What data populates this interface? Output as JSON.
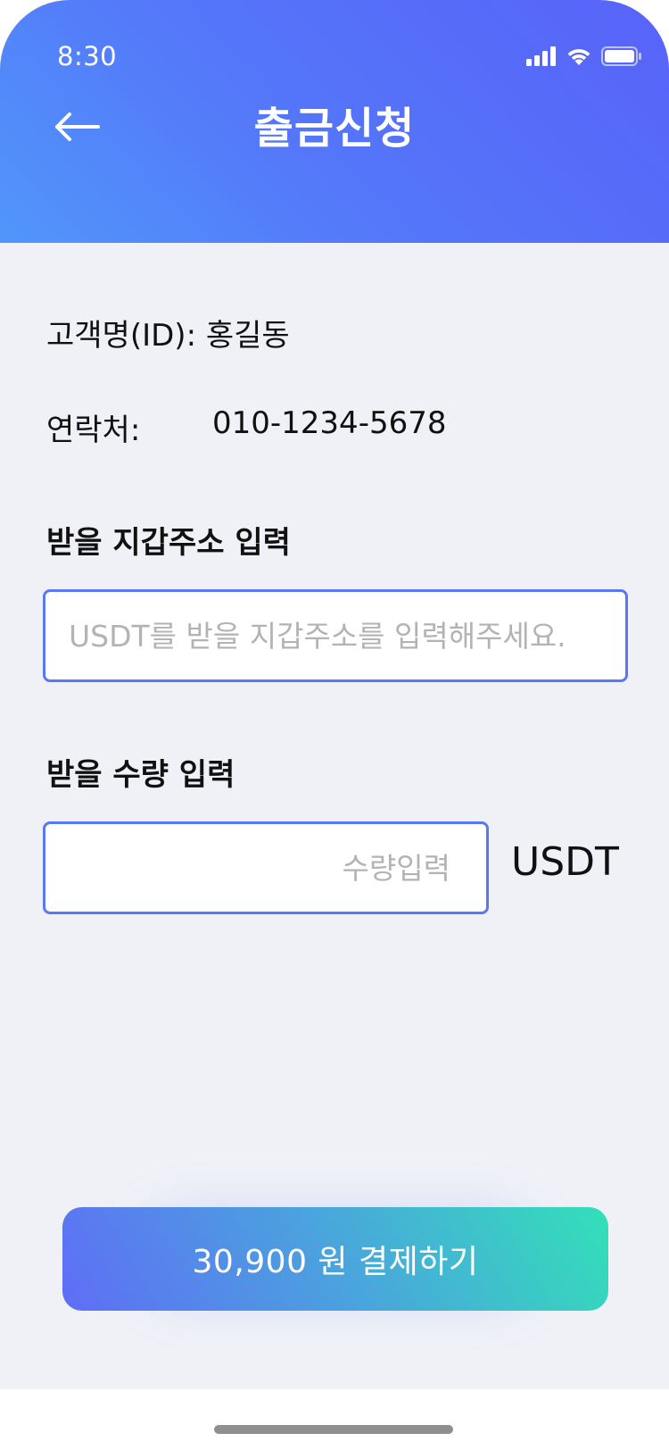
{
  "status_bar": {
    "time": "8:30"
  },
  "header": {
    "title": "출금신청"
  },
  "customer": {
    "name_label": "고객명(ID):",
    "name_value": "홍길동",
    "phone_label": "연락처:",
    "phone_value": "010-1234-5678"
  },
  "wallet": {
    "label": "받을 지갑주소 입력",
    "placeholder": "USDT를 받을 지갑주소를 입력해주세요.",
    "value": ""
  },
  "amount": {
    "label": "받을 수량 입력",
    "placeholder": "수량입력",
    "value": "",
    "unit": "USDT"
  },
  "pay_button": {
    "label": "30,900 원 결제하기"
  },
  "icons": {
    "back": "arrow-left-icon",
    "signal": "cellular-signal-icon",
    "wifi": "wifi-icon",
    "battery": "battery-icon"
  },
  "colors": {
    "header_gradient_start": "#5196fb",
    "header_gradient_end": "#5863f9",
    "input_border": "#5a78f2",
    "button_gradient_start": "#5f6df6",
    "button_gradient_end": "#33e0b8",
    "content_background": "#f0f1f7"
  }
}
